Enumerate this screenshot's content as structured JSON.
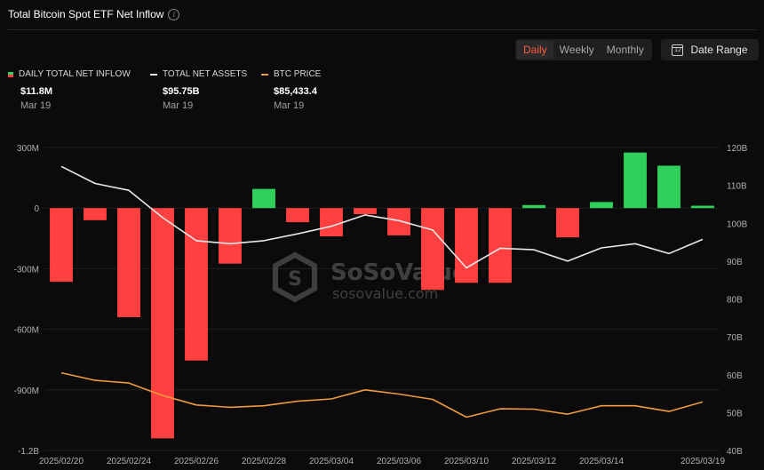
{
  "header": {
    "title": "Total Bitcoin Spot ETF Net Inflow",
    "info_icon": "info-icon"
  },
  "controls": {
    "ranges": [
      "Daily",
      "Weekly",
      "Monthly"
    ],
    "active_range": "Daily",
    "date_range_label": "Date Range",
    "date_range_icon": "calendar-icon"
  },
  "legend": [
    {
      "label": "DAILY TOTAL NET INFLOW",
      "value": "$11.8M",
      "date": "Mar 19"
    },
    {
      "label": "TOTAL NET ASSETS",
      "value": "$95.75B",
      "date": "Mar 19"
    },
    {
      "label": "BTC PRICE",
      "value": "$85,433.4",
      "date": "Mar 19"
    }
  ],
  "watermark": {
    "name": "SoSoValue",
    "url": "sosovalue.com"
  },
  "colors": {
    "positive": "#2fd15c",
    "negative": "#ff4040",
    "assets_line": "#e8e8e8",
    "price_line": "#f09a3e",
    "background": "#0b0b0b",
    "active_tab": "#ff5a3d"
  },
  "chart_data": {
    "type": "bar",
    "x": [
      "2025/02/20",
      "2025/02/21",
      "2025/02/24",
      "2025/02/25",
      "2025/02/26",
      "2025/02/27",
      "2025/02/28",
      "2025/03/03",
      "2025/03/04",
      "2025/03/05",
      "2025/03/06",
      "2025/03/07",
      "2025/03/10",
      "2025/03/11",
      "2025/03/12",
      "2025/03/13",
      "2025/03/14",
      "2025/03/17",
      "2025/03/18",
      "2025/03/19"
    ],
    "x_tick_labels": [
      "2025/02/20",
      "2025/02/24",
      "2025/02/26",
      "2025/02/28",
      "2025/03/04",
      "2025/03/06",
      "2025/03/10",
      "2025/03/12",
      "2025/03/14",
      "2025/03/19"
    ],
    "series": [
      {
        "name": "DAILY TOTAL NET INFLOW",
        "kind": "bar",
        "axis": "left",
        "unit": "M",
        "values": [
          -365,
          -60,
          -540,
          -1140,
          -755,
          -275,
          95,
          -70,
          -140,
          -30,
          -135,
          -405,
          -370,
          -370,
          15,
          -145,
          30,
          275,
          210,
          11.8
        ]
      },
      {
        "name": "TOTAL NET ASSETS",
        "kind": "line",
        "axis": "right",
        "unit": "B",
        "values": [
          115,
          110.5,
          108.7,
          101.5,
          95.4,
          94.6,
          95.4,
          97.2,
          99.2,
          102.2,
          100.7,
          98.2,
          88.2,
          93.4,
          93.0,
          90.0,
          93.5,
          94.6,
          92.0,
          95.75
        ]
      },
      {
        "name": "BTC PRICE",
        "kind": "line",
        "axis": "right",
        "unit": "price",
        "values": [
          60.5,
          58.5,
          57.8,
          54.5,
          52.0,
          51.4,
          51.8,
          53.0,
          53.6,
          56.0,
          54.9,
          53.5,
          48.8,
          51.0,
          50.9,
          49.6,
          51.8,
          51.8,
          50.3,
          52.8
        ]
      }
    ],
    "y_left": {
      "min": -1200,
      "max": 300,
      "ticks": [
        300,
        0,
        -300,
        -600,
        -900,
        -1200
      ],
      "tick_labels": [
        "300M",
        "0",
        "-300M",
        "-600M",
        "-900M",
        "-1.2B"
      ]
    },
    "y_right": {
      "min": 40,
      "max": 120,
      "ticks": [
        120,
        110,
        100,
        90,
        80,
        70,
        60,
        50,
        40
      ],
      "tick_labels": [
        "120B",
        "110B",
        "100B",
        "90B",
        "80B",
        "70B",
        "60B",
        "50B",
        "40B"
      ]
    },
    "grid": true
  }
}
